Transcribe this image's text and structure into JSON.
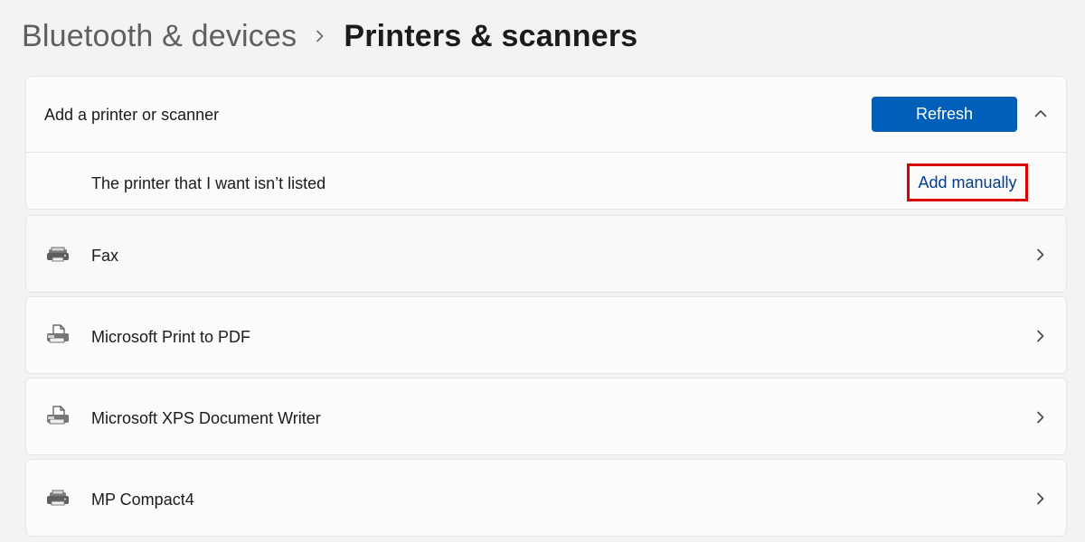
{
  "breadcrumb": {
    "parent": "Bluetooth & devices",
    "current": "Printers & scanners",
    "separator_icon": "chevron-right-icon"
  },
  "add_printer": {
    "label": "Add a printer or scanner",
    "refresh_label": "Refresh",
    "collapse_icon": "chevron-up-icon",
    "manual_text": "The printer that I want isn’t listed",
    "manual_action": "Add manually"
  },
  "devices": [
    {
      "label": "Fax",
      "icon": "fax-printer-icon"
    },
    {
      "label": "Microsoft Print to PDF",
      "icon": "document-printer-icon"
    },
    {
      "label": "Microsoft XPS Document Writer",
      "icon": "document-printer-icon"
    },
    {
      "label": "MP Compact4",
      "icon": "printer-icon"
    }
  ],
  "colors": {
    "accent": "#005fb8",
    "link": "#003e92",
    "highlight": "#d80000",
    "background": "#f3f3f3"
  }
}
